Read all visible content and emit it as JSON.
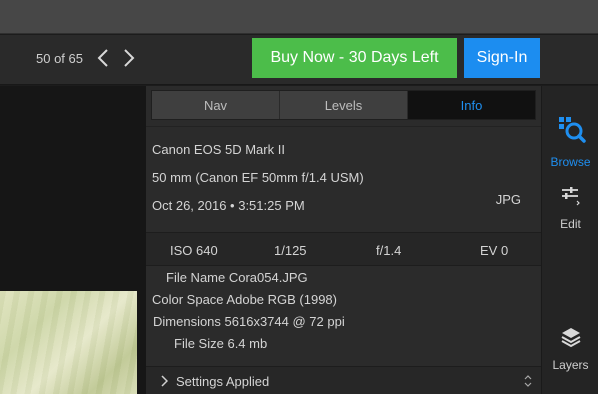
{
  "toolbar": {
    "counter": "50 of 65",
    "buy_label": "Buy Now - 30 Days Left",
    "signin_label": "Sign-In",
    "prev_icon": "chevron-left-icon",
    "next_icon": "chevron-right-icon"
  },
  "tabs": [
    {
      "label": "Nav",
      "active": false
    },
    {
      "label": "Levels",
      "active": false
    },
    {
      "label": "Info",
      "active": true
    }
  ],
  "camera": {
    "model": "Canon EOS 5D Mark II",
    "lens": "50 mm (Canon EF 50mm f/1.4 USM)",
    "datetime": "Oct 26, 2016 • 3:51:25 PM",
    "format": "JPG"
  },
  "exif": {
    "iso": "ISO 640",
    "shutter": "1/125",
    "aperture": "f/1.4",
    "ev": "EV 0"
  },
  "file": {
    "name": "File Name Cora054.JPG",
    "color_space": "Color Space Adobe RGB (1998)",
    "dimensions": "Dimensions 5616x3744 @ 72 ppi",
    "size": "File Size 6.4 mb"
  },
  "settings": {
    "label": "Settings Applied"
  },
  "sidebar": {
    "items": [
      {
        "label": "Browse",
        "icon": "browse-icon",
        "active": true
      },
      {
        "label": "Edit",
        "icon": "sliders-icon",
        "active": false
      },
      {
        "label": "Layers",
        "icon": "layers-icon",
        "active": false
      }
    ]
  },
  "colors": {
    "accent": "#1f8ff0",
    "buy": "#4cbd4a",
    "signin": "#1c8df0"
  }
}
